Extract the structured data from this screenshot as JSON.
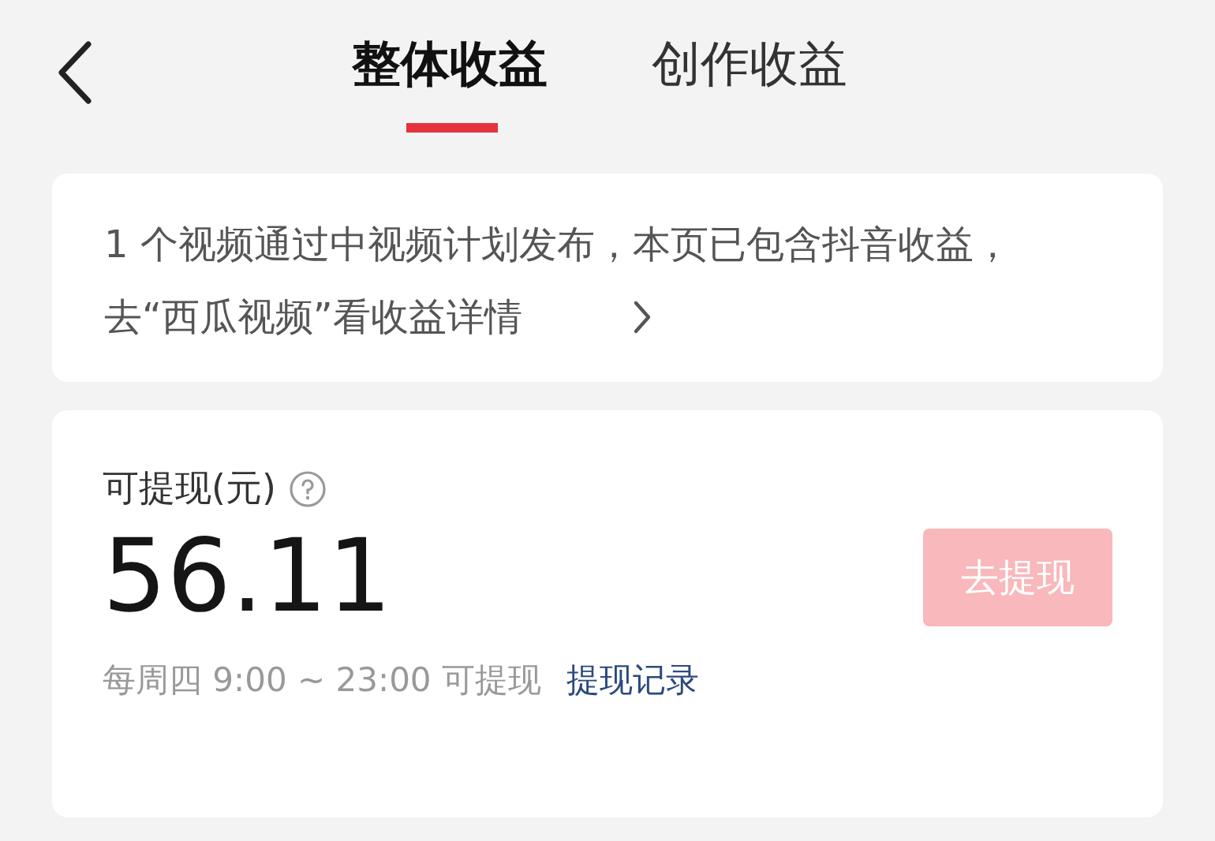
{
  "header": {
    "tabs": [
      {
        "label": "整体收益",
        "selected": true
      },
      {
        "label": "创作收益",
        "selected": false
      }
    ]
  },
  "notice": {
    "text": "1 个视频通过中视频计划发布，本页已包含抖音收益，去“西瓜视频”看收益详情"
  },
  "balance": {
    "label": "可提现(元)",
    "amount": "56.11",
    "withdraw_button": {
      "label": "去提现",
      "disabled": true
    },
    "schedule": "每周四 9:00 ~ 23:00 可提现",
    "records_link": "提现记录"
  }
}
